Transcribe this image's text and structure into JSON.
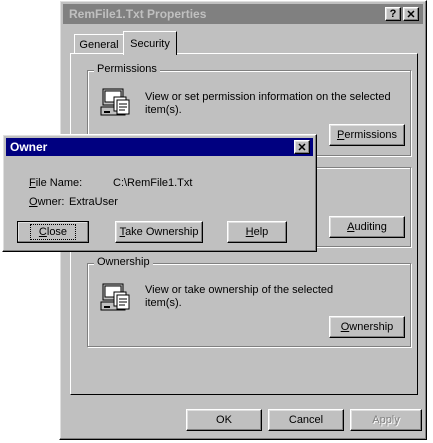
{
  "properties_window": {
    "title": "RemFile1.Txt Properties",
    "help_button": "?",
    "close_button": "✕",
    "tabs": [
      {
        "label": "General"
      },
      {
        "label": "Security"
      }
    ],
    "groups": {
      "permissions": {
        "legend": "Permissions",
        "description": "View or set permission information on the selected item(s).",
        "button": {
          "pre": "",
          "u": "P",
          "post": "ermissions"
        }
      },
      "auditing": {
        "button": {
          "pre": "",
          "u": "A",
          "post": "uditing"
        }
      },
      "ownership": {
        "legend": "Ownership",
        "description": "View or take ownership of the selected item(s).",
        "button": {
          "pre": "",
          "u": "O",
          "post": "wnership"
        }
      }
    },
    "footer": {
      "ok": "OK",
      "cancel": "Cancel",
      "apply": "Apply"
    }
  },
  "owner_dialog": {
    "title": "Owner",
    "close_button": "✕",
    "file_name_label": {
      "u": "F",
      "rest": "ile Name:"
    },
    "file_name_value": "C:\\RemFile1.Txt",
    "owner_label": {
      "u": "O",
      "rest": "wner:"
    },
    "owner_value": "ExtraUser",
    "buttons": {
      "close": {
        "u": "C",
        "rest": "lose"
      },
      "take_ownership": {
        "u": "T",
        "rest": "ake Ownership"
      },
      "help": {
        "u": "H",
        "rest": "elp"
      }
    }
  },
  "icons": {
    "permissions": "computer-files-icon",
    "ownership": "computer-files-icon"
  }
}
